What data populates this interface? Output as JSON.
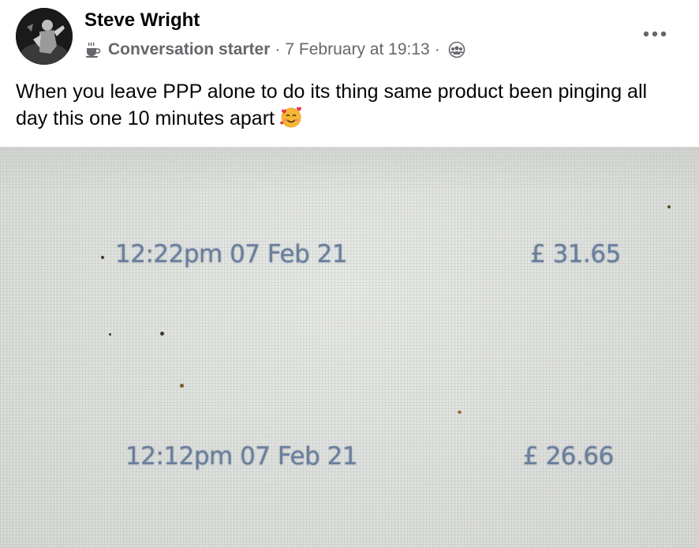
{
  "post": {
    "author": "Steve Wright",
    "badge_icon": "coffee-cup-icon",
    "badge_label": "Conversation starter",
    "separator": "·",
    "date": "7 February at 19:13",
    "audience_icon": "group-audience-icon",
    "more_icon": "more-dots-icon",
    "text": "When you leave PPP alone to do its thing same product been pinging all day this one 10 minutes apart",
    "emoji_icon": "smiling-face-with-hearts-icon"
  },
  "photo": {
    "sales": [
      {
        "time": "12:22pm 07 Feb 21",
        "price": "£ 31.65"
      },
      {
        "time": "12:12pm 07 Feb 21",
        "price": "£ 26.66"
      }
    ],
    "text_color": "#6a7f9c"
  }
}
